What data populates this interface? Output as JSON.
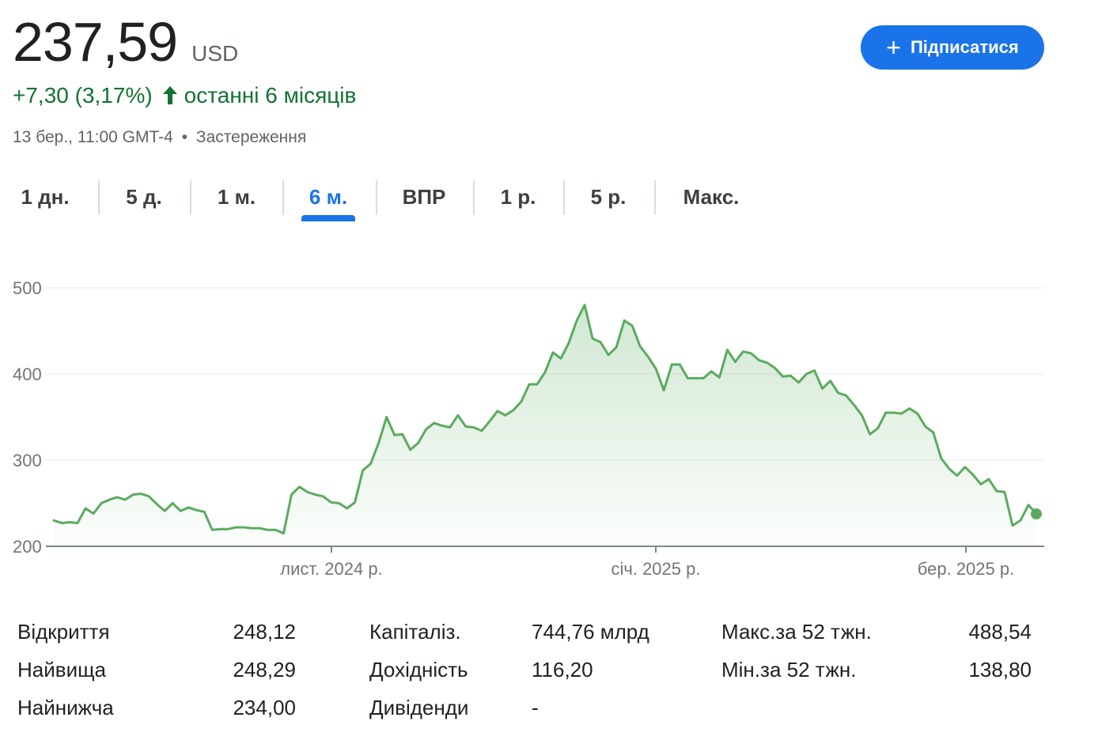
{
  "quote": {
    "price": "237,59",
    "currency": "USD",
    "change": "+7,30 (3,17%)",
    "period": "останні 6 місяців",
    "timestamp": "13 бер., 11:00 GMT-4",
    "separator": "•",
    "disclaimer": "Застереження",
    "up_color": "#137333"
  },
  "subscribe": {
    "label": "Підписатися",
    "icon": "plus-icon"
  },
  "tabs": [
    {
      "label": "1 дн.",
      "active": false
    },
    {
      "label": "5 д.",
      "active": false
    },
    {
      "label": "1 м.",
      "active": false
    },
    {
      "label": "6 м.",
      "active": true
    },
    {
      "label": "ВПР",
      "active": false
    },
    {
      "label": "1 р.",
      "active": false
    },
    {
      "label": "5 р.",
      "active": false
    },
    {
      "label": "Макс.",
      "active": false
    }
  ],
  "chart_data": {
    "type": "area",
    "title": "",
    "xlabel": "",
    "ylabel": "",
    "ylim": [
      200,
      500
    ],
    "y_ticks": [
      "500",
      "400",
      "300",
      "200"
    ],
    "x_ticks": [
      "лист. 2024 р.",
      "січ. 2025 р.",
      "бер. 2025 р."
    ],
    "line_color": "#5bab5f",
    "grid": true,
    "series": [
      {
        "values": [
          230,
          227,
          228,
          227,
          244,
          238,
          250,
          254,
          257,
          254,
          260,
          261,
          258,
          249,
          241,
          250,
          241,
          245,
          242,
          240,
          219,
          220,
          220,
          222,
          222,
          221,
          221,
          219,
          219,
          215,
          260,
          269,
          263,
          260,
          258,
          251,
          250,
          244,
          251,
          288,
          296,
          320,
          350,
          329,
          330,
          312,
          320,
          336,
          343,
          340,
          338,
          352,
          339,
          338,
          334,
          345,
          357,
          352,
          358,
          368,
          388,
          388,
          402,
          425,
          418,
          436,
          462,
          480,
          441,
          437,
          422,
          431,
          462,
          456,
          432,
          420,
          406,
          381,
          411,
          411,
          395,
          395,
          395,
          403,
          396,
          428,
          414,
          426,
          424,
          416,
          413,
          407,
          397,
          398,
          390,
          400,
          404,
          383,
          392,
          378,
          375,
          364,
          352,
          330,
          337,
          355,
          355,
          354,
          360,
          354,
          339,
          332,
          302,
          290,
          282,
          292,
          283,
          272,
          278,
          264,
          263,
          224,
          230,
          248,
          238
        ],
        "last_value": 237.59
      }
    ]
  },
  "stats": {
    "col1": [
      {
        "label": "Відкриття",
        "value": "248,12"
      },
      {
        "label": "Найвища",
        "value": "248,29"
      },
      {
        "label": "Найнижча",
        "value": "234,00"
      }
    ],
    "col2": [
      {
        "label": "Капіталіз.",
        "value": "744,76 млрд"
      },
      {
        "label": "Дохідність",
        "value": "116,20"
      },
      {
        "label": "Дивіденди",
        "value": "-"
      }
    ],
    "col3": [
      {
        "label": "Макс.за 52 тжн.",
        "value": "488,54"
      },
      {
        "label": "Мін.за 52 тжн.",
        "value": "138,80"
      }
    ]
  }
}
